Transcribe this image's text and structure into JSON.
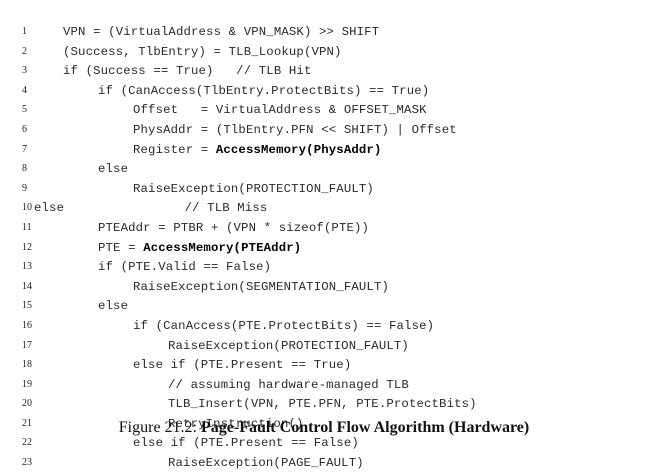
{
  "listing": {
    "lines": [
      {
        "num": "1",
        "indent": 0,
        "before": "VPN = (VirtualAddress & VPN_MASK) >> SHIFT",
        "bold": "",
        "after": ""
      },
      {
        "num": "2",
        "indent": 0,
        "before": "(Success, TlbEntry) = TLB_Lookup(VPN)",
        "bold": "",
        "after": ""
      },
      {
        "num": "3",
        "indent": 0,
        "before": "if (Success == True)   // TLB Hit",
        "bold": "",
        "after": ""
      },
      {
        "num": "4",
        "indent": 1,
        "before": "if (CanAccess(TlbEntry.ProtectBits) == True)",
        "bold": "",
        "after": ""
      },
      {
        "num": "5",
        "indent": 2,
        "before": "Offset   = VirtualAddress & OFFSET_MASK",
        "bold": "",
        "after": ""
      },
      {
        "num": "6",
        "indent": 2,
        "before": "PhysAddr = (TlbEntry.PFN << SHIFT) | Offset",
        "bold": "",
        "after": ""
      },
      {
        "num": "7",
        "indent": 2,
        "before": "Register = ",
        "bold": "AccessMemory(PhysAddr)",
        "after": ""
      },
      {
        "num": "8",
        "indent": 1,
        "before": "else",
        "bold": "",
        "after": ""
      },
      {
        "num": "9",
        "indent": 2,
        "before": "RaiseException(PROTECTION_FAULT)",
        "bold": "",
        "after": ""
      },
      {
        "num": "10",
        "indent": -1,
        "before": "else                // TLB Miss",
        "bold": "",
        "after": ""
      },
      {
        "num": "11",
        "indent": 1,
        "before": "PTEAddr = PTBR + (VPN * sizeof(PTE))",
        "bold": "",
        "after": ""
      },
      {
        "num": "12",
        "indent": 1,
        "before": "PTE = ",
        "bold": "AccessMemory(PTEAddr)",
        "after": ""
      },
      {
        "num": "13",
        "indent": 1,
        "before": "if (PTE.Valid == False)",
        "bold": "",
        "after": ""
      },
      {
        "num": "14",
        "indent": 2,
        "before": "RaiseException(SEGMENTATION_FAULT)",
        "bold": "",
        "after": ""
      },
      {
        "num": "15",
        "indent": 1,
        "before": "else",
        "bold": "",
        "after": ""
      },
      {
        "num": "16",
        "indent": 2,
        "before": "if (CanAccess(PTE.ProtectBits) == False)",
        "bold": "",
        "after": ""
      },
      {
        "num": "17",
        "indent": 3,
        "before": "RaiseException(PROTECTION_FAULT)",
        "bold": "",
        "after": ""
      },
      {
        "num": "18",
        "indent": 2,
        "before": "else if (PTE.Present == True)",
        "bold": "",
        "after": ""
      },
      {
        "num": "19",
        "indent": 3,
        "before": "// assuming hardware-managed TLB",
        "bold": "",
        "after": ""
      },
      {
        "num": "20",
        "indent": 3,
        "before": "TLB_Insert(VPN, PTE.PFN, PTE.ProtectBits)",
        "bold": "",
        "after": ""
      },
      {
        "num": "21",
        "indent": 3,
        "before": "RetryInstruction()",
        "bold": "",
        "after": ""
      },
      {
        "num": "22",
        "indent": 2,
        "before": "else if (PTE.Present == False)",
        "bold": "",
        "after": ""
      },
      {
        "num": "23",
        "indent": 3,
        "before": "RaiseException(PAGE_FAULT)",
        "bold": "",
        "after": ""
      }
    ]
  },
  "caption": {
    "label": "Figure 21.2:",
    "title": "Page-Fault Control Flow Algorithm (Hardware)"
  }
}
